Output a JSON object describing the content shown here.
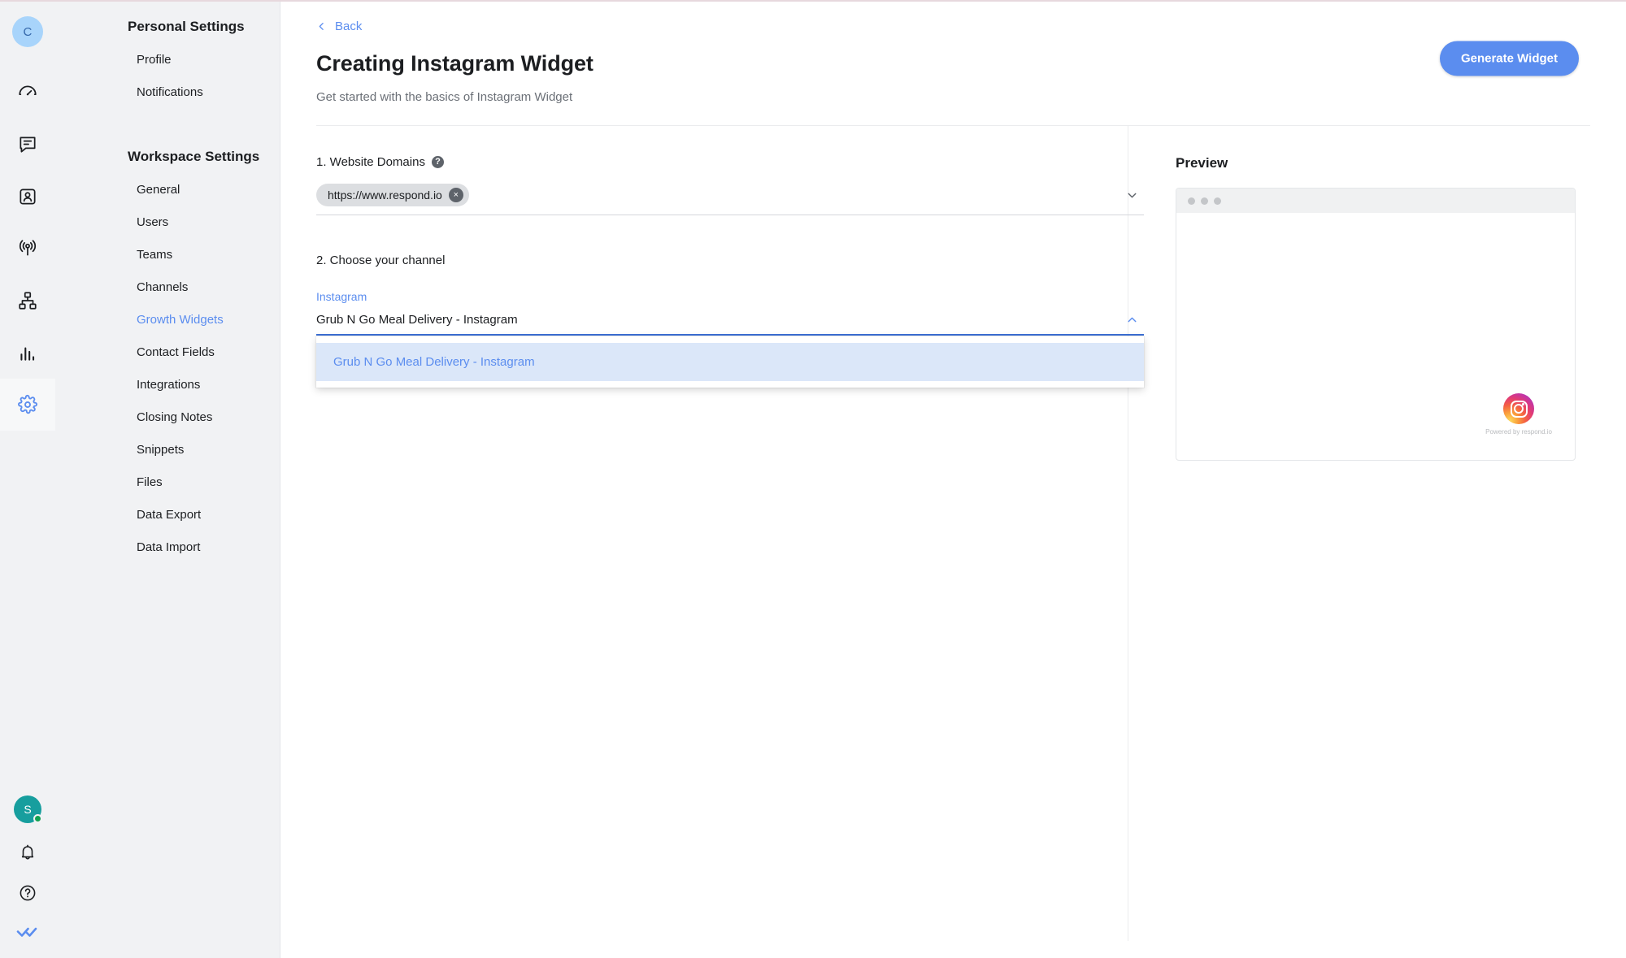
{
  "rail": {
    "workspace_avatar": "C",
    "user_avatar": "S",
    "icons": [
      {
        "name": "dashboard-icon",
        "label": "Dashboard"
      },
      {
        "name": "messages-icon",
        "label": "Messages"
      },
      {
        "name": "contacts-icon",
        "label": "Contacts"
      },
      {
        "name": "broadcasts-icon",
        "label": "Broadcasts"
      },
      {
        "name": "workflows-icon",
        "label": "Workflows"
      },
      {
        "name": "reports-icon",
        "label": "Reports"
      },
      {
        "name": "settings-icon",
        "label": "Settings"
      }
    ],
    "bottom_icons": [
      {
        "name": "notifications-bell-icon",
        "label": "Notifications"
      },
      {
        "name": "help-circle-icon",
        "label": "Help"
      },
      {
        "name": "respond-io-logo",
        "label": "respond.io"
      }
    ]
  },
  "sidebar": {
    "personal_heading": "Personal Settings",
    "personal_items": [
      {
        "label": "Profile"
      },
      {
        "label": "Notifications"
      }
    ],
    "workspace_heading": "Workspace Settings",
    "workspace_items": [
      {
        "label": "General"
      },
      {
        "label": "Users"
      },
      {
        "label": "Teams"
      },
      {
        "label": "Channels"
      },
      {
        "label": "Growth Widgets"
      },
      {
        "label": "Contact Fields"
      },
      {
        "label": "Integrations"
      },
      {
        "label": "Closing Notes"
      },
      {
        "label": "Snippets"
      },
      {
        "label": "Files"
      },
      {
        "label": "Data Export"
      },
      {
        "label": "Data Import"
      }
    ],
    "active_item": "Growth Widgets"
  },
  "header": {
    "back_label": "Back",
    "title": "Creating Instagram Widget",
    "subtitle": "Get started with the basics of Instagram Widget",
    "generate_button": "Generate Widget"
  },
  "form": {
    "step1_label": "1. Website Domains",
    "help_glyph": "?",
    "domain_chips": [
      {
        "value": "https://www.respond.io",
        "remove_glyph": "×"
      }
    ],
    "step2_label": "2. Choose your channel",
    "channel_type_label": "Instagram",
    "selected_channel": "Grub N Go Meal Delivery - Instagram",
    "dropdown_options": [
      {
        "label": "Grub N Go Meal Delivery - Instagram",
        "selected": true
      }
    ]
  },
  "preview": {
    "title": "Preview",
    "powered_by": "Powered by respond.io",
    "widget_icon": "instagram-icon"
  },
  "colors": {
    "accent_blue": "#5b8def",
    "sidebar_bg": "#f1f2f4",
    "option_highlight": "#dbe7f9",
    "avatar_blue": "#a8d4fb",
    "user_teal": "#179e9e",
    "status_green": "#12a150"
  }
}
